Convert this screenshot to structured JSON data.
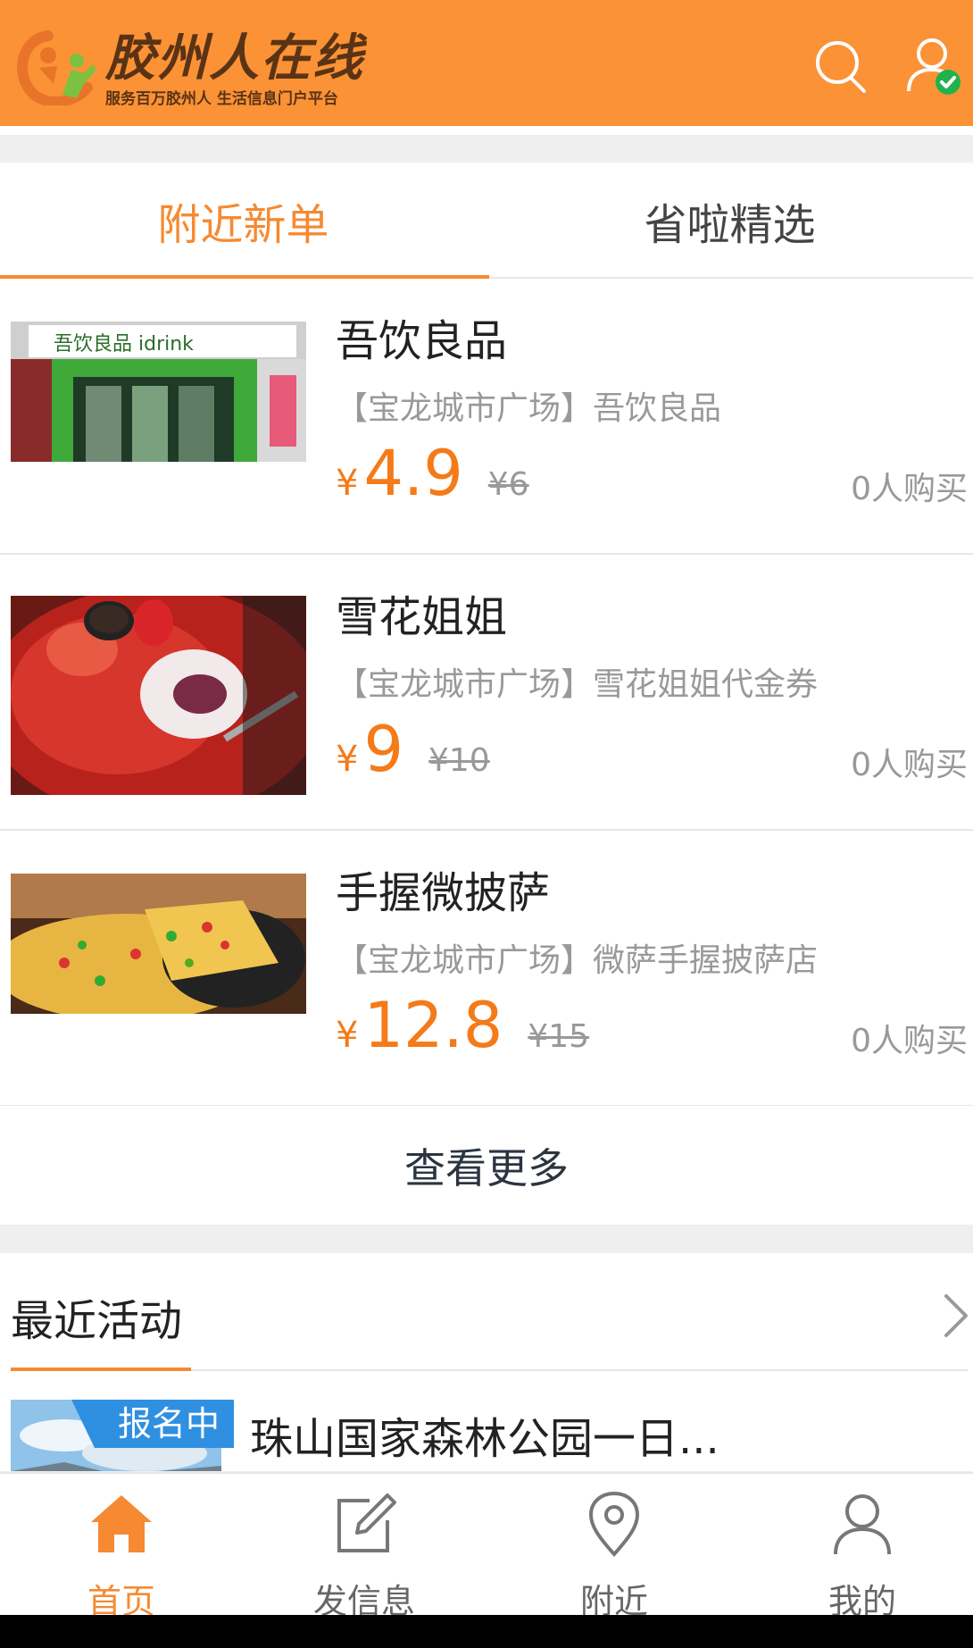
{
  "header": {
    "title": "胶州人在线",
    "subtitle": "服务百万胶州人 生活信息门户平台",
    "search_icon": "search-icon",
    "user_icon": "user-verified-icon",
    "brand_color": "#fb9236"
  },
  "tabs": [
    {
      "label": "附近新单",
      "active": true
    },
    {
      "label": "省啦精选",
      "active": false
    }
  ],
  "deals": [
    {
      "title": "吾饮良品",
      "subtitle": "【宝龙城市广场】吾饮良品",
      "currency": "¥",
      "price": "4.9",
      "original": "¥6",
      "bought": "0人购买",
      "sign_text": "吾饮良品 idrink"
    },
    {
      "title": "雪花姐姐",
      "subtitle": "【宝龙城市广场】雪花姐姐代金券",
      "currency": "¥",
      "price": "9",
      "original": "¥10",
      "bought": "0人购买"
    },
    {
      "title": "手握微披萨",
      "subtitle": "【宝龙城市广场】微萨手握披萨店",
      "currency": "¥",
      "price": "12.8",
      "original": "¥15",
      "bought": "0人购买"
    }
  ],
  "more_label": "查看更多",
  "activity": {
    "title": "最近活动",
    "items": [
      {
        "badge": "报名中",
        "text": "珠山国家森林公园一日..."
      }
    ]
  },
  "bottom_nav": [
    {
      "label": "首页",
      "icon": "home-icon",
      "active": true
    },
    {
      "label": "发信息",
      "icon": "edit-icon",
      "active": false
    },
    {
      "label": "附近",
      "icon": "location-pin-icon",
      "active": false
    },
    {
      "label": "我的",
      "icon": "person-icon",
      "active": false
    }
  ],
  "colors": {
    "accent": "#f58a32",
    "price": "#f57a18",
    "badge": "#2f8fe0"
  }
}
